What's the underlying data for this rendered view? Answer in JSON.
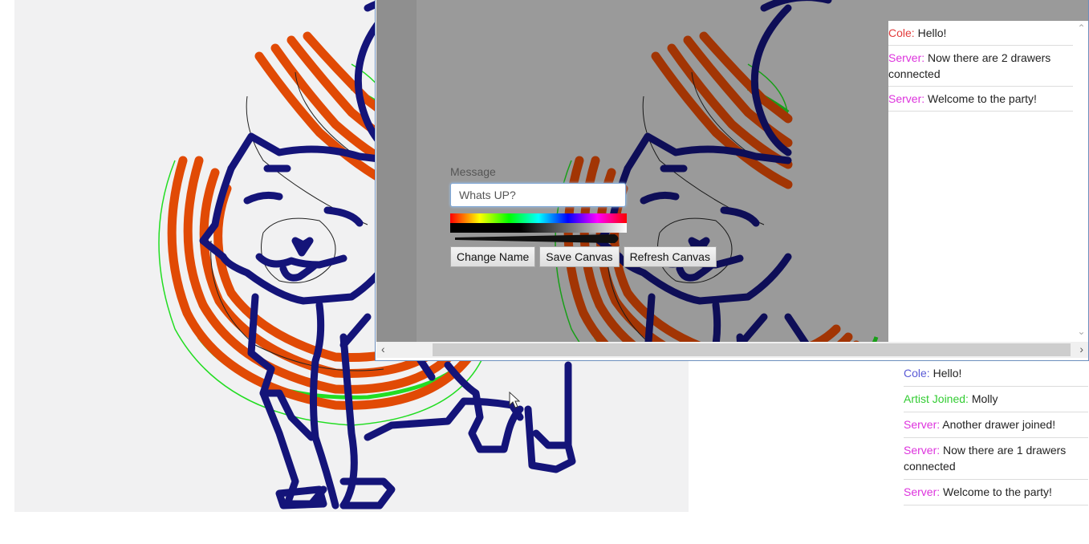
{
  "bg_chat": [
    {
      "sender": "Cole:",
      "sender_color": "#5a5ad6",
      "text": "Hello!"
    },
    {
      "sender": "Artist Joined:",
      "sender_color": "#33cc33",
      "text": "Molly"
    },
    {
      "sender": "Server:",
      "sender_color": "#dd33dd",
      "text": "Another drawer joined!"
    },
    {
      "sender": "Server:",
      "sender_color": "#dd33dd",
      "text": "Now there are 1 drawers connected"
    },
    {
      "sender": "Server:",
      "sender_color": "#dd33dd",
      "text": "Welcome to the party!"
    }
  ],
  "win_chat": [
    {
      "sender": "Cole:",
      "sender_color": "#e23b3b",
      "text": "Hello!"
    },
    {
      "sender": "Server:",
      "sender_color": "#dd33dd",
      "text": "Now there are 2 drawers connected"
    },
    {
      "sender": "Server:",
      "sender_color": "#dd33dd",
      "text": "Welcome to the party!"
    }
  ],
  "controls": {
    "message_label": "Message",
    "message_value": "Whats UP?",
    "change_name": "Change Name",
    "save_canvas": "Save Canvas",
    "refresh_canvas": "Refresh Canvas"
  },
  "colors": {
    "orange": "#e14a05",
    "navy": "#141479",
    "green": "#22dd22",
    "ink": "#222222"
  },
  "icons": {
    "scroll_left": "chevron-left-icon",
    "scroll_right": "chevron-right-icon",
    "scroll_up": "chevron-up-icon",
    "scroll_down": "chevron-down-icon",
    "cursor": "mouse-pointer-icon"
  }
}
